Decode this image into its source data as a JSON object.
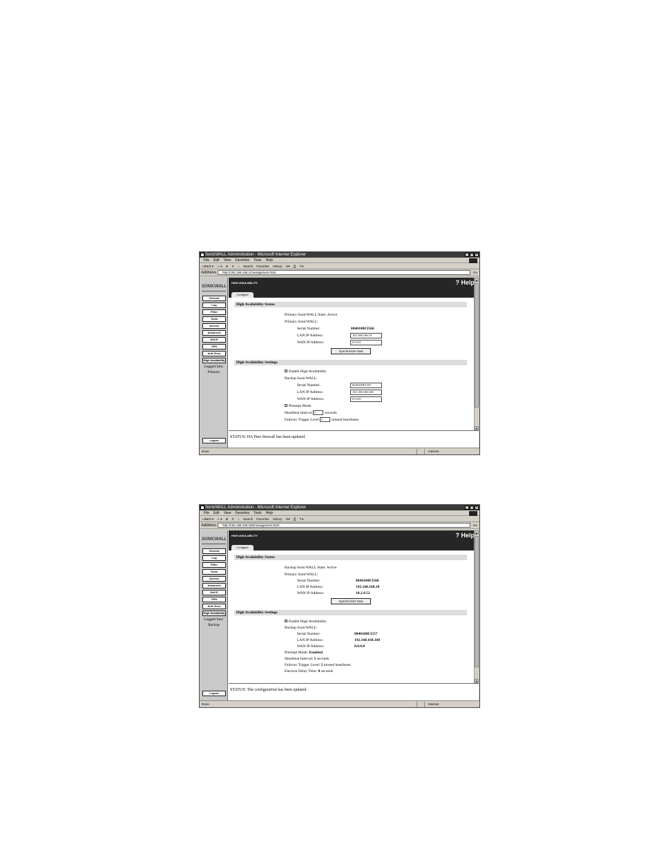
{
  "browser": {
    "title": "SonicWALL Administration - Microsoft Internet Explorer",
    "menu": [
      "File",
      "Edit",
      "View",
      "Favorites",
      "Tools",
      "Help"
    ],
    "toolbar": [
      "⇦Back ▾",
      "⇨ ▾",
      "⊗",
      "↻",
      "⌂",
      "Search",
      "Favorites",
      "History",
      "✉▾",
      "⎙",
      "✎▾",
      "□",
      "↔"
    ],
    "address_label": "Address",
    "go": "Go",
    "status_done": "Done",
    "zone": "Internet"
  },
  "app": {
    "logo": "SONICWALL",
    "nav": [
      "General",
      "Log",
      "Filter",
      "Tools",
      "Access",
      "Advanced",
      "DHCP",
      "VPN",
      "Anti-Virus",
      "High Availability"
    ],
    "logged_into_label": "Logged Into:",
    "logout": "Logout",
    "page_title": "HIGH AVAILABILITY",
    "help": "Help",
    "tab": "Configure",
    "sec_status": "High Availability Status",
    "sec_settings": "High Availability Settings",
    "serial": "Serial Number:",
    "lan": "LAN IP Address:",
    "wan": "WAN IP Address:",
    "sync": "Synchronize Now",
    "enable_ha": "Enable High Availability",
    "backup_label": "Backup SonicWALL:",
    "primary_label": "Primary SonicWALL:"
  },
  "screen1": {
    "url": "http://192.168.168.1/management.html",
    "state": "Primary SonicWALL State: Active",
    "primary_serial": "0040100F2566",
    "primary_lan": "192.168.168.10",
    "primary_wan": "0.0.0.0",
    "backup_serial": "0040100F1557",
    "backup_lan": "192.168.168.168",
    "backup_wan": "0.0.0.0",
    "preempt": "Preempt Mode",
    "heartbeat_label": "Heartbeat Interval",
    "heartbeat_value": "5",
    "heartbeat_unit": "seconds",
    "failover_label": "Failover Trigger Level",
    "failover_value": "5",
    "failover_unit": "missed heartbeats",
    "logged_into": "Primary",
    "status": "STATUS: HA Peer firewall has been updated."
  },
  "screen2": {
    "url": "http://192.168.168.168/management.html",
    "state": "Backup SonicWALL State: Active",
    "primary_serial": "0040100F2566",
    "primary_lan": "192.168.168.10",
    "primary_wan": "10.2.4.52",
    "backup_serial": "0040100F1557",
    "backup_lan": "192.168.168.168",
    "backup_wan": "0.0.0.0",
    "preempt_label": "Preempt Mode:",
    "preempt_value": "Enabled",
    "heartbeat_label": "Heartbeat Interval:",
    "heartbeat_value": "5",
    "heartbeat_unit": "seconds",
    "failover_label": "Failover Trigger Level:",
    "failover_value": "5",
    "failover_unit": "missed heartbeats",
    "election_label": "Election Delay Time:",
    "election_value": "0",
    "election_unit": "seconds",
    "logged_into": "Backup",
    "status": "STATUS: The configuration has been updated."
  }
}
